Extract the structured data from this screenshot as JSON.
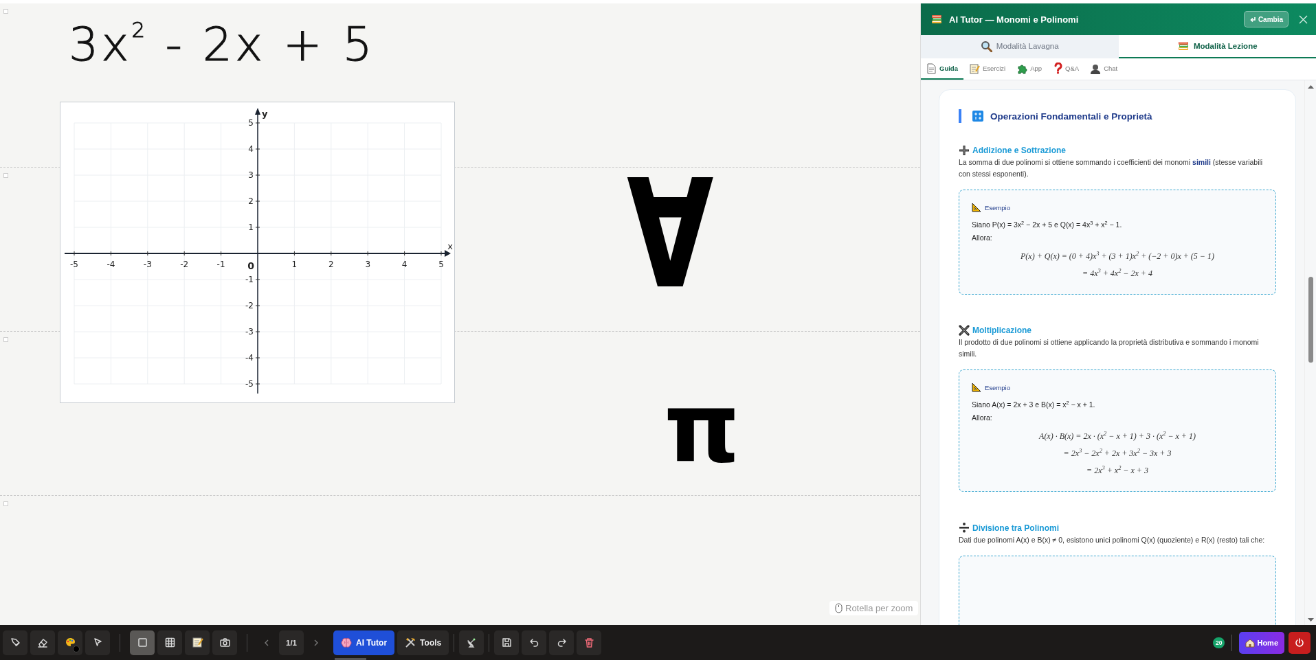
{
  "board": {
    "formula": "3x$^{2}$ - 2x + 5",
    "symbols": [
      "∀",
      "π"
    ],
    "graph": {
      "x_axis": "x",
      "y_axis": "y",
      "origin": "0",
      "x_ticks": [
        "-5",
        "-4",
        "-3",
        "-2",
        "-1",
        "1",
        "2",
        "3",
        "4",
        "5"
      ],
      "y_ticks": [
        "5",
        "4",
        "3",
        "2",
        "1",
        "-1",
        "-2",
        "-3",
        "-4",
        "-5"
      ]
    },
    "zoom_hint": "Rotella per zoom"
  },
  "panel": {
    "title": "AI Tutor — Monomi e Polinomi",
    "switch_button": "Cambia",
    "modes": [
      {
        "label": "Modalità Lavagna",
        "selected": false
      },
      {
        "label": "Modalità Lezione",
        "selected": true
      }
    ],
    "tabs": [
      {
        "label": "Guida",
        "selected": true
      },
      {
        "label": "Esercizi",
        "selected": false
      },
      {
        "label": "App",
        "selected": false
      },
      {
        "label": "Q&A",
        "selected": false
      },
      {
        "label": "Chat",
        "selected": false
      }
    ],
    "section_title": "Operazioni Fondamentali e Proprietà",
    "subsections": [
      {
        "title": "Addizione e Sottrazione",
        "text": "La somma di due polinomi si ottiene sommando i coefficienti dei monomi **simili** (stesse variabili con stessi esponenti).",
        "example": {
          "label": "Esempio",
          "intro": "Siano P(x) = 3x$^{2}$ − 2x + 5 e Q(x) = 4x$^{3}$ + x$^{2}$ − 1.",
          "then": "Allora:",
          "equations": [
            "P(x) + Q(x) = (0 + 4)x$^{3}$ + (3 + 1)x$^{2}$ + (−2 + 0)x + (5 − 1)",
            "= 4x$^{3}$ + 4x$^{2}$ − 2x + 4"
          ]
        }
      },
      {
        "title": "Moltiplicazione",
        "text": "Il prodotto di due polinomi si ottiene applicando la proprietà distributiva e sommando i monomi simili.",
        "example": {
          "label": "Esempio",
          "intro": "Siano A(x) = 2x + 3 e B(x) = x$^{2}$ − x + 1.",
          "then": "Allora:",
          "equations": [
            "A(x) · B(x) = 2x · (x$^{2}$ − x + 1) + 3 · (x$^{2}$ − x + 1)",
            "= 2x$^{3}$ − 2x$^{2}$ + 2x + 3x$^{2}$ − 3x + 3",
            "= 2x$^{3}$ + x$^{2}$ − x + 3"
          ]
        }
      },
      {
        "title": "Divisione tra Polinomi",
        "text": "Dati due polinomi A(x) e B(x) ≠ 0, esistono unici polinomi Q(x) (quoziente) e R(x) (resto) tali che:"
      }
    ]
  },
  "toolbar": {
    "draw_tools": [
      {
        "selected": false
      },
      {
        "selected": false
      },
      {
        "selected": false
      },
      {
        "selected": false
      }
    ],
    "insert_tools": [
      {
        "selected": true
      },
      {
        "selected": false
      },
      {
        "selected": false
      },
      {
        "selected": false
      }
    ],
    "page": "1/1",
    "ai_button": "AI Tutor",
    "tools_button": "Tools",
    "badge": "20",
    "home_button": "Home"
  }
}
